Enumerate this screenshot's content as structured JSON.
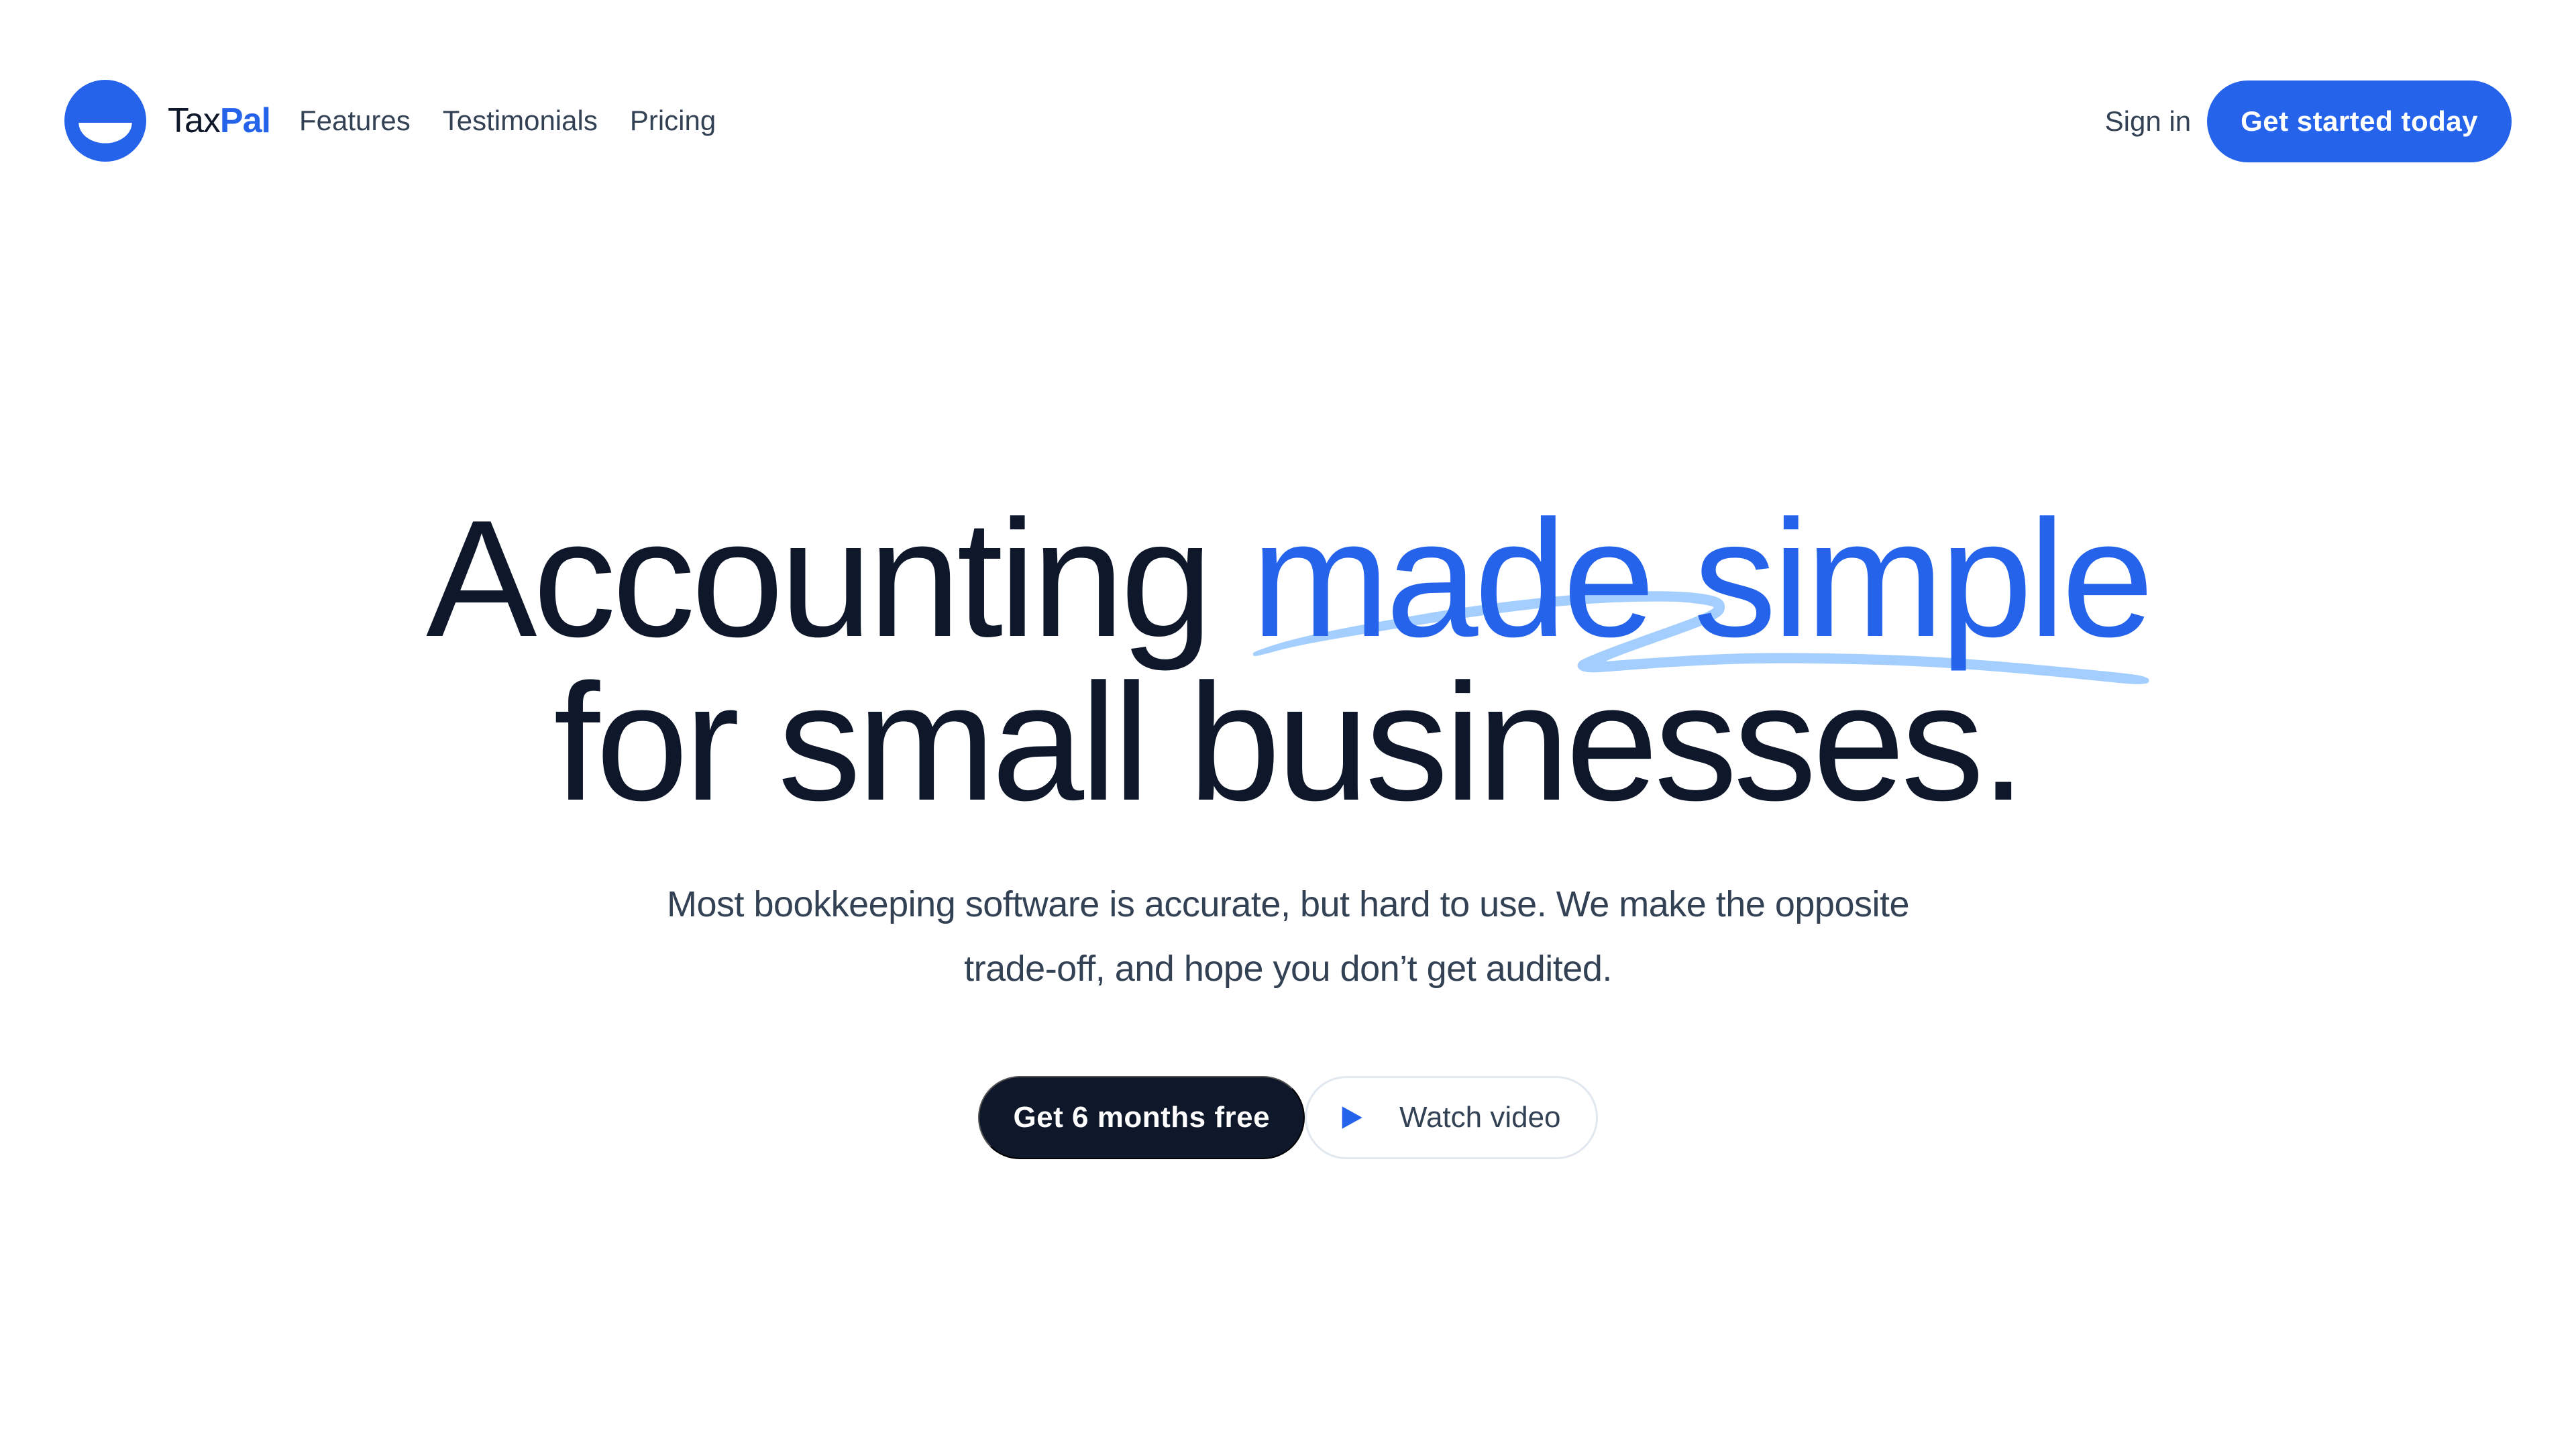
{
  "header": {
    "logo": {
      "word_a": "Tax",
      "word_b": "Pal"
    },
    "nav": [
      {
        "label": "Features"
      },
      {
        "label": "Testimonials"
      },
      {
        "label": "Pricing"
      }
    ],
    "sign_in_label": "Sign in",
    "cta_label": "Get started today"
  },
  "hero": {
    "title_line1_plain": "Accounting ",
    "title_line1_accent": "made simple",
    "title_line2": "for small businesses.",
    "subtitle": "Most bookkeeping software is accurate, but hard to use. We make the opposite trade-off, and hope you don’t get audited.",
    "primary_cta_label": "Get 6 months free",
    "secondary_cta_label": "Watch video"
  },
  "icons": {
    "logo": "taxpal-logo-icon",
    "play": "play-icon"
  },
  "colors": {
    "brand_blue": "#2563eb",
    "dark": "#0f172a",
    "text_muted": "#334155",
    "underline": "#93c5fd",
    "outline_border": "#e2e8f0"
  }
}
